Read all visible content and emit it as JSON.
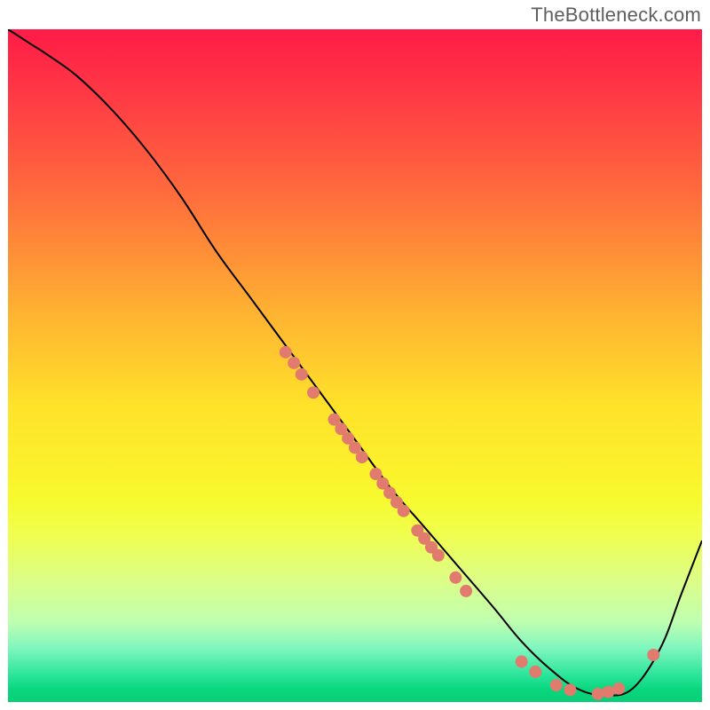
{
  "attribution": "TheBottleneck.com",
  "colors": {
    "curve": "#000000",
    "dot": "#e07b6e"
  },
  "chart_data": {
    "type": "line",
    "title": "",
    "xlabel": "",
    "ylabel": "",
    "xlim": [
      0,
      100
    ],
    "ylim": [
      0,
      100
    ],
    "grid": false,
    "series": [
      {
        "name": "bottleneck-curve",
        "x": [
          0,
          3,
          6,
          10,
          15,
          20,
          25,
          30,
          35,
          40,
          45,
          50,
          55,
          60,
          65,
          70,
          74,
          78,
          82,
          86,
          90,
          94,
          97,
          100
        ],
        "y": [
          100,
          98,
          96,
          93,
          88,
          82,
          75,
          67,
          60,
          53,
          46,
          39,
          32,
          26,
          20,
          14,
          9,
          5,
          2,
          1,
          2,
          8,
          16,
          24
        ]
      }
    ],
    "scatter": [
      {
        "name": "cluster-upper-1",
        "x": 40.0,
        "y": 52.0
      },
      {
        "name": "cluster-upper-2",
        "x": 41.2,
        "y": 50.4
      },
      {
        "name": "cluster-upper-3",
        "x": 42.3,
        "y": 48.7
      },
      {
        "name": "cluster-upper-4",
        "x": 44.0,
        "y": 46.0
      },
      {
        "name": "cluster-mid-1",
        "x": 47.0,
        "y": 42.0
      },
      {
        "name": "cluster-mid-2",
        "x": 48.0,
        "y": 40.6
      },
      {
        "name": "cluster-mid-3",
        "x": 49.0,
        "y": 39.2
      },
      {
        "name": "cluster-mid-4",
        "x": 50.0,
        "y": 37.8
      },
      {
        "name": "cluster-mid-5",
        "x": 51.0,
        "y": 36.4
      },
      {
        "name": "cluster-mid-6",
        "x": 53.0,
        "y": 33.9
      },
      {
        "name": "cluster-mid-7",
        "x": 54.0,
        "y": 32.5
      },
      {
        "name": "cluster-mid-8",
        "x": 55.0,
        "y": 31.1
      },
      {
        "name": "cluster-mid-9",
        "x": 56.0,
        "y": 29.7
      },
      {
        "name": "cluster-mid-10",
        "x": 57.0,
        "y": 28.4
      },
      {
        "name": "cluster-low-1",
        "x": 59.0,
        "y": 25.5
      },
      {
        "name": "cluster-low-2",
        "x": 60.0,
        "y": 24.3
      },
      {
        "name": "cluster-low-3",
        "x": 61.0,
        "y": 23.0
      },
      {
        "name": "cluster-low-4",
        "x": 62.0,
        "y": 21.8
      },
      {
        "name": "cluster-low-5",
        "x": 64.5,
        "y": 18.5
      },
      {
        "name": "cluster-low-6",
        "x": 66.0,
        "y": 16.5
      },
      {
        "name": "bottom-1",
        "x": 74.0,
        "y": 6.0
      },
      {
        "name": "bottom-2",
        "x": 76.0,
        "y": 4.5
      },
      {
        "name": "bottom-3",
        "x": 79.0,
        "y": 2.5
      },
      {
        "name": "bottom-4",
        "x": 81.0,
        "y": 1.8
      },
      {
        "name": "bottom-5",
        "x": 85.0,
        "y": 1.2
      },
      {
        "name": "bottom-6",
        "x": 86.5,
        "y": 1.5
      },
      {
        "name": "bottom-7",
        "x": 88.0,
        "y": 2.0
      },
      {
        "name": "rise-1",
        "x": 93.0,
        "y": 7.0
      }
    ]
  }
}
